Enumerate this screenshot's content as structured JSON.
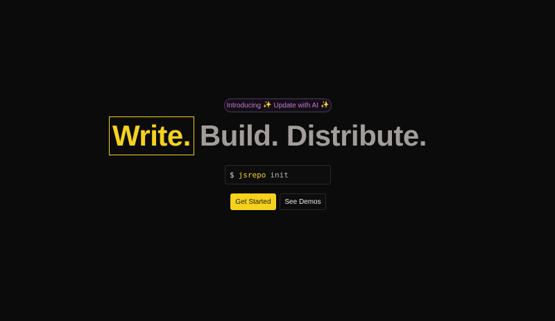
{
  "badge": {
    "intro_text": "Introducing",
    "feature_text": "Update with AI",
    "spark_glyph": "✨"
  },
  "headline": {
    "highlighted_word": "Write.",
    "rest_text": "Build. Distribute."
  },
  "command": {
    "prompt": "$",
    "tool": "jsrepo",
    "argument": "init"
  },
  "buttons": {
    "primary_label": "Get Started",
    "secondary_label": "See Demos"
  },
  "colors": {
    "background": "#0c0b0b",
    "accent_yellow": "#f5d21b",
    "muted_gray": "#a29d9b",
    "badge_purple": "#c07ad6"
  },
  "icons": {
    "badge_left": "sparkles-icon",
    "badge_right": "sparkles-icon"
  }
}
